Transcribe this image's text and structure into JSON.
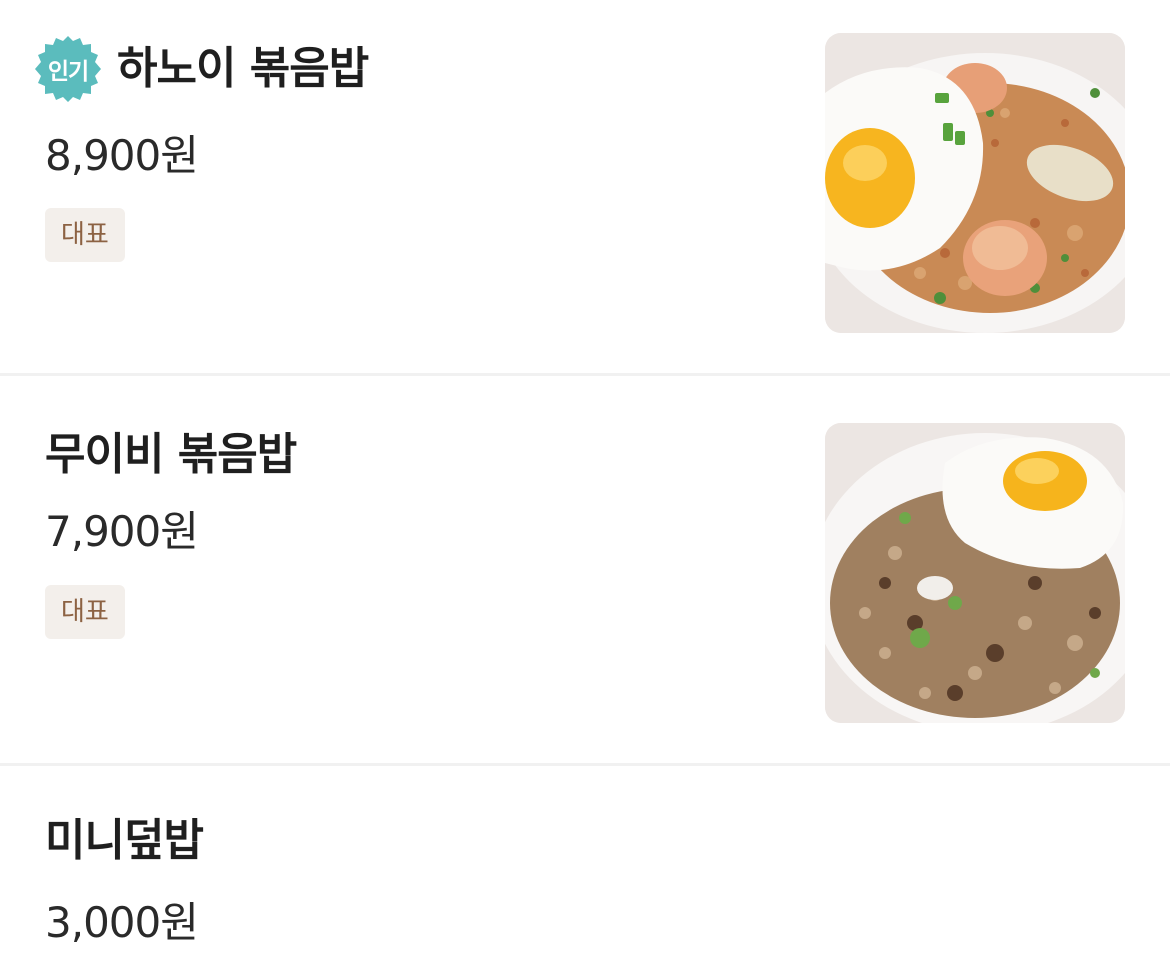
{
  "menu": {
    "items": [
      {
        "badge": "인기",
        "name": "하노이 볶음밥",
        "price": "8,900원",
        "tag": "대표",
        "image_icon": "fried-rice-shrimp-egg-photo"
      },
      {
        "name": "무이비 볶음밥",
        "price": "7,900원",
        "tag": "대표",
        "image_icon": "fried-rice-beef-egg-photo"
      },
      {
        "name": "미니덮밥",
        "price": "3,000원"
      }
    ]
  },
  "colors": {
    "popular_badge": "#5bbcbd",
    "tag_background": "#f3efeb",
    "tag_text": "#8c6243",
    "divider": "#f1f1f1"
  }
}
